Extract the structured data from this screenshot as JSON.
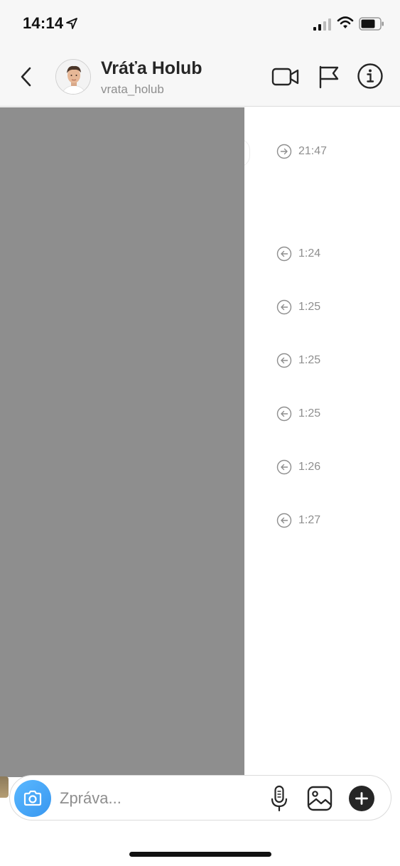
{
  "status_bar": {
    "time": "14:14"
  },
  "header": {
    "name": "Vráťa Holub",
    "username": "vrata_holub"
  },
  "messages": [
    {
      "direction": "sent",
      "icon": "arrow-right-circle-icon",
      "time": "21:47"
    },
    {
      "direction": "received",
      "icon": "arrow-left-circle-icon",
      "time": "1:24"
    },
    {
      "direction": "received",
      "icon": "arrow-left-circle-icon",
      "time": "1:25"
    },
    {
      "direction": "received",
      "icon": "arrow-left-circle-icon",
      "time": "1:25"
    },
    {
      "direction": "received",
      "icon": "arrow-left-circle-icon",
      "time": "1:25"
    },
    {
      "direction": "received",
      "icon": "arrow-left-circle-icon",
      "time": "1:26"
    },
    {
      "direction": "received",
      "icon": "arrow-left-circle-icon",
      "time": "1:27"
    }
  ],
  "composer": {
    "placeholder": "Zpráva...",
    "value": ""
  },
  "colors": {
    "accent": "#3897f0",
    "text": "#262626",
    "secondary_text": "#8e8e8e",
    "redaction": "#8e8e8e"
  }
}
